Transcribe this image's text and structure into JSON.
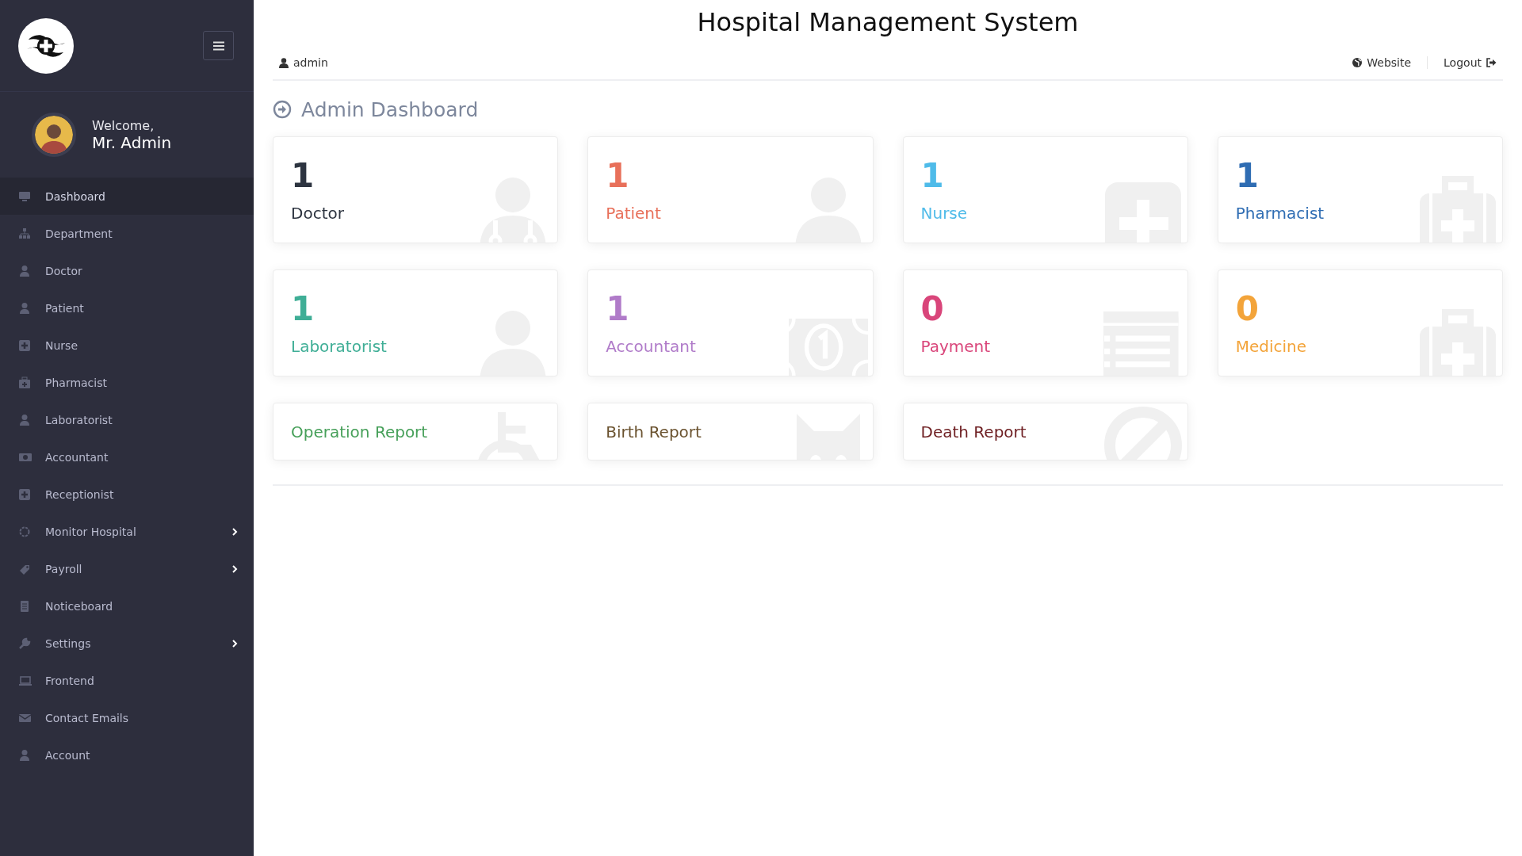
{
  "sidebar": {
    "welcome": "Welcome,",
    "user_name": "Mr. Admin",
    "items": [
      {
        "label": "Dashboard",
        "selected": true,
        "has_submenu": false
      },
      {
        "label": "Department",
        "selected": false,
        "has_submenu": false
      },
      {
        "label": "Doctor",
        "selected": false,
        "has_submenu": false
      },
      {
        "label": "Patient",
        "selected": false,
        "has_submenu": false
      },
      {
        "label": "Nurse",
        "selected": false,
        "has_submenu": false
      },
      {
        "label": "Pharmacist",
        "selected": false,
        "has_submenu": false
      },
      {
        "label": "Laboratorist",
        "selected": false,
        "has_submenu": false
      },
      {
        "label": "Accountant",
        "selected": false,
        "has_submenu": false
      },
      {
        "label": "Receptionist",
        "selected": false,
        "has_submenu": false
      },
      {
        "label": "Monitor Hospital",
        "selected": false,
        "has_submenu": true
      },
      {
        "label": "Payroll",
        "selected": false,
        "has_submenu": true
      },
      {
        "label": "Noticeboard",
        "selected": false,
        "has_submenu": false
      },
      {
        "label": "Settings",
        "selected": false,
        "has_submenu": true
      },
      {
        "label": "Frontend",
        "selected": false,
        "has_submenu": false
      },
      {
        "label": "Contact Emails",
        "selected": false,
        "has_submenu": false
      },
      {
        "label": "Account",
        "selected": false,
        "has_submenu": false
      }
    ]
  },
  "header": {
    "title": "Hospital Management System",
    "user": "admin",
    "website_link": "Website",
    "logout_link": "Logout"
  },
  "page_title": "Admin Dashboard",
  "cards": [
    {
      "kind": "stat",
      "count": "1",
      "label": "Doctor",
      "color": "#2d3440"
    },
    {
      "kind": "stat",
      "count": "1",
      "label": "Patient",
      "color": "#e8705a"
    },
    {
      "kind": "stat",
      "count": "1",
      "label": "Nurse",
      "color": "#4fbbe9"
    },
    {
      "kind": "stat",
      "count": "1",
      "label": "Pharmacist",
      "color": "#2f6db3"
    },
    {
      "kind": "stat",
      "count": "1",
      "label": "Laboratorist",
      "color": "#3fae96"
    },
    {
      "kind": "stat",
      "count": "1",
      "label": "Accountant",
      "color": "#b07bc9"
    },
    {
      "kind": "stat",
      "count": "0",
      "label": "Payment",
      "color": "#d9457a"
    },
    {
      "kind": "stat",
      "count": "0",
      "label": "Medicine",
      "color": "#f3a43a"
    },
    {
      "kind": "report",
      "label": "Operation Report",
      "color": "#47a05a"
    },
    {
      "kind": "report",
      "label": "Birth Report",
      "color": "#6b5330"
    },
    {
      "kind": "report",
      "label": "Death Report",
      "color": "#6e1f22"
    }
  ]
}
